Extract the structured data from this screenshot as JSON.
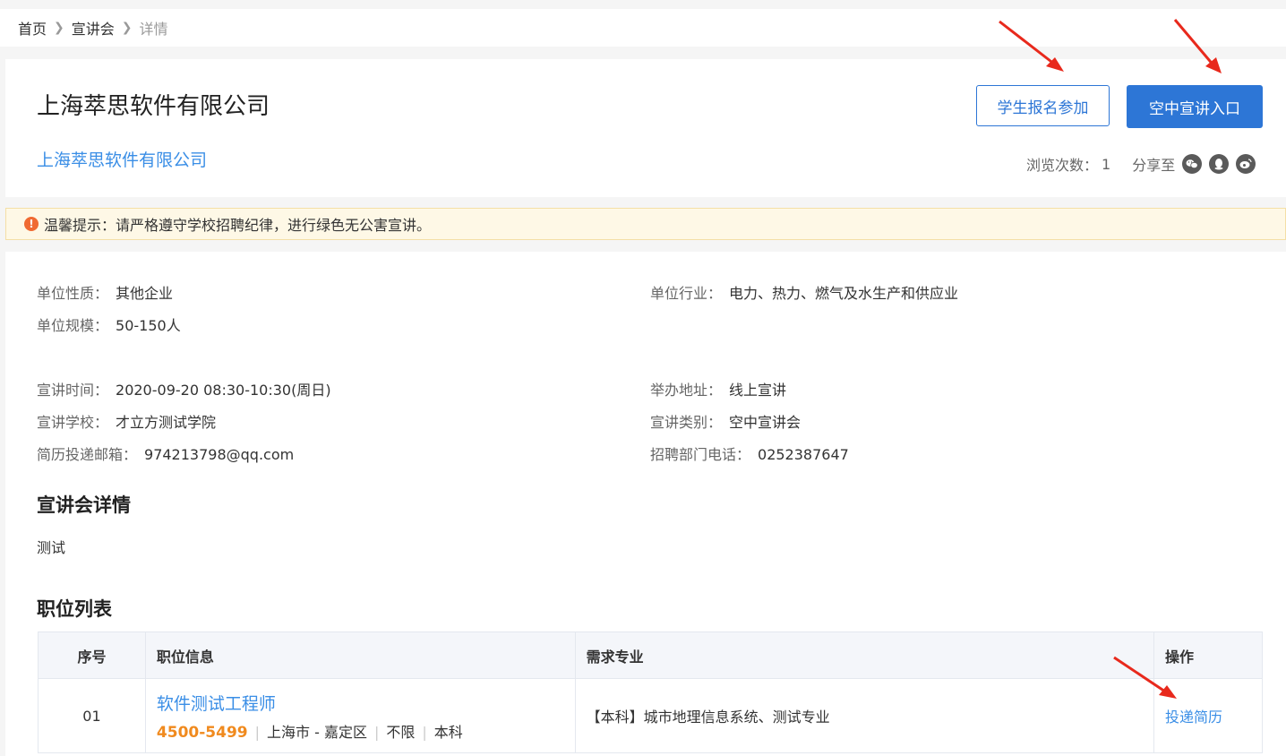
{
  "breadcrumb": {
    "home": "首页",
    "section": "宣讲会",
    "current": "详情"
  },
  "header": {
    "title": "上海萃思软件有限公司",
    "company_link": "上海萃思软件有限公司",
    "signup_button": "学生报名参加",
    "air_entry_button": "空中宣讲入口",
    "views_label": "浏览次数：",
    "views_value": "1",
    "share_label": "分享至",
    "share_icons": [
      "wechat-icon",
      "qq-icon",
      "weibo-icon"
    ]
  },
  "notice": {
    "text": "温馨提示：请严格遵守学校招聘纪律，进行绿色无公害宣讲。"
  },
  "company_info": {
    "nature_label": "单位性质：",
    "nature": "其他企业",
    "industry_label": "单位行业：",
    "industry": "电力、热力、燃气及水生产和供应业",
    "scale_label": "单位规模：",
    "scale": "50-150人"
  },
  "event_info": {
    "time_label": "宣讲时间：",
    "time": "2020-09-20 08:30-10:30(周日)",
    "address_label": "举办地址：",
    "address": "线上宣讲",
    "school_label": "宣讲学校：",
    "school": "才立方测试学院",
    "type_label": "宣讲类别：",
    "type": "空中宣讲会",
    "email_label": "简历投递邮箱：",
    "email": "974213798@qq.com",
    "phone_label": "招聘部门电话：",
    "phone": "0252387647"
  },
  "details": {
    "title": "宣讲会详情",
    "text": "测试"
  },
  "positions": {
    "title": "职位列表",
    "headers": [
      "序号",
      "职位信息",
      "需求专业",
      "操作"
    ],
    "rows": [
      {
        "index": "01",
        "job_title": "软件测试工程师",
        "salary": "4500-5499",
        "location": "上海市 - 嘉定区",
        "experience": "不限",
        "education": "本科",
        "major": "【本科】城市地理信息系统、测试专业",
        "action": "投递简历"
      }
    ]
  },
  "colors": {
    "primary": "#2d76d6",
    "link": "#3a8ee6",
    "salary": "#f08a1e",
    "arrow": "#e8291c",
    "notice_bg": "#fef8e6"
  }
}
